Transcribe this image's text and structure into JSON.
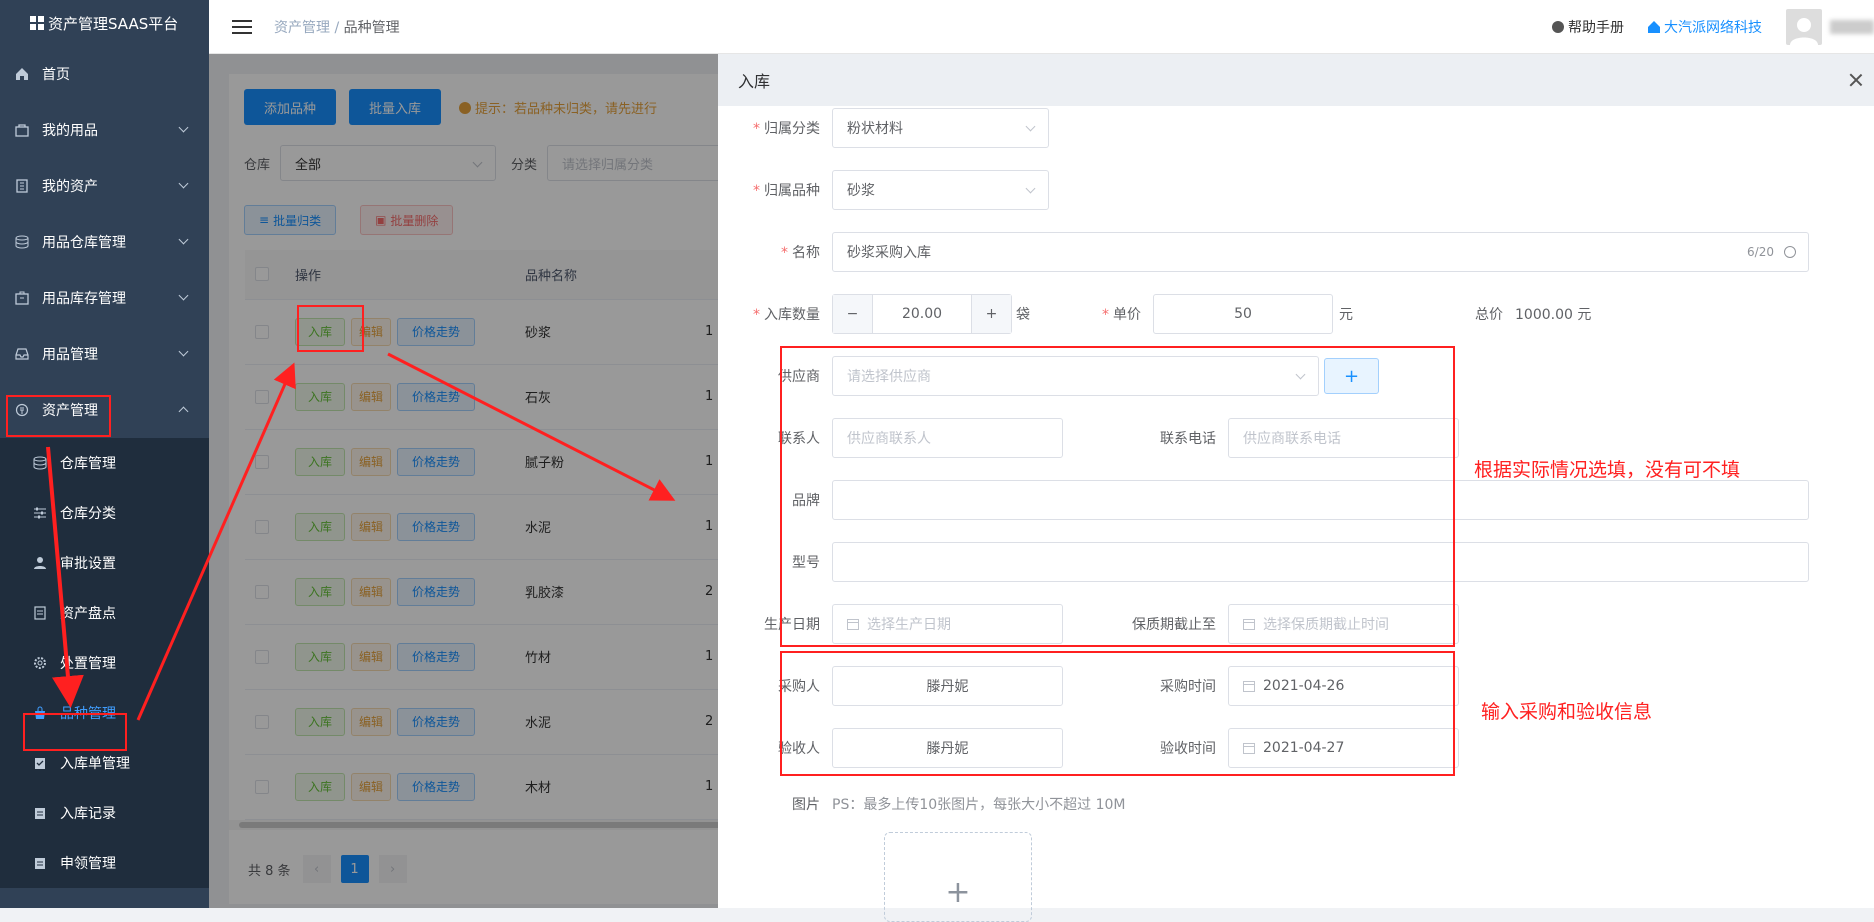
{
  "app_title": "资产管理SAAS平台",
  "sidebar": {
    "items": [
      {
        "label": "首页"
      },
      {
        "label": "我的用品"
      },
      {
        "label": "我的资产"
      },
      {
        "label": "用品仓库管理"
      },
      {
        "label": "用品库存管理"
      },
      {
        "label": "用品管理"
      },
      {
        "label": "资产管理"
      }
    ],
    "sub_items": [
      {
        "label": "仓库管理"
      },
      {
        "label": "仓库分类"
      },
      {
        "label": "审批设置"
      },
      {
        "label": "资产盘点"
      },
      {
        "label": "处置管理"
      },
      {
        "label": "品种管理"
      },
      {
        "label": "入库单管理"
      },
      {
        "label": "入库记录"
      },
      {
        "label": "申领管理"
      }
    ]
  },
  "header": {
    "breadcrumb_root": "资产管理",
    "breadcrumb_sep": "/",
    "breadcrumb_current": "品种管理",
    "help": "帮助手册",
    "company": "大汽派网络科技"
  },
  "main": {
    "add_button": "添加品种",
    "batch_in_button": "批量入库",
    "tip": "提示：若品种未归类，请先进行",
    "warehouse_label": "仓库",
    "warehouse_value": "全部",
    "category_label": "分类",
    "category_placeholder": "请选择归属分类",
    "batch_classify": "批量归类",
    "batch_delete": "批量删除",
    "col_action": "操作",
    "col_name": "品种名称",
    "btn_in": "入库",
    "btn_edit": "编辑",
    "btn_trend": "价格走势",
    "rows": [
      {
        "name": "砂浆",
        "extra": "1"
      },
      {
        "name": "石灰",
        "extra": "1"
      },
      {
        "name": "腻子粉",
        "extra": "1"
      },
      {
        "name": "水泥",
        "extra": "1"
      },
      {
        "name": "乳胶漆",
        "extra": "2"
      },
      {
        "name": "竹材",
        "extra": "1"
      },
      {
        "name": "水泥",
        "extra": "2"
      },
      {
        "name": "木材",
        "extra": "1"
      }
    ],
    "total": "共 8 条",
    "page": "1"
  },
  "drawer": {
    "title": "入库",
    "category_label": "归属分类",
    "category_value": "粉状材料",
    "variety_label": "归属品种",
    "variety_value": "砂浆",
    "name_label": "名称",
    "name_value": "砂浆采购入库",
    "name_count": "6/20",
    "qty_label": "入库数量",
    "qty_value": "20.00",
    "qty_unit": "袋",
    "price_label": "单价",
    "price_value": "50",
    "price_unit": "元",
    "total_label": "总价",
    "total_value": "1000.00 元",
    "supplier_label": "供应商",
    "supplier_placeholder": "请选择供应商",
    "contact_label": "联系人",
    "contact_placeholder": "供应商联系人",
    "phone_label": "联系电话",
    "phone_placeholder": "供应商联系电话",
    "brand_label": "品牌",
    "model_label": "型号",
    "prod_date_label": "生产日期",
    "prod_date_placeholder": "选择生产日期",
    "expiry_label": "保质期截止至",
    "expiry_placeholder": "选择保质期截止时间",
    "buyer_label": "采购人",
    "buyer_value": "滕丹妮",
    "buy_time_label": "采购时间",
    "buy_time_value": "2021-04-26",
    "checker_label": "验收人",
    "checker_value": "滕丹妮",
    "check_time_label": "验收时间",
    "check_time_value": "2021-04-27",
    "image_label": "图片",
    "image_hint": "PS：最多上传10张图片，每张大小不超过 10M"
  },
  "annotations": {
    "optional_note": "根据实际情况选填，没有可不填",
    "purchase_note": "输入采购和验收信息"
  },
  "colors": {
    "sidebar": "#304156",
    "accent": "#1890ff",
    "annotation": "#ff2020"
  }
}
